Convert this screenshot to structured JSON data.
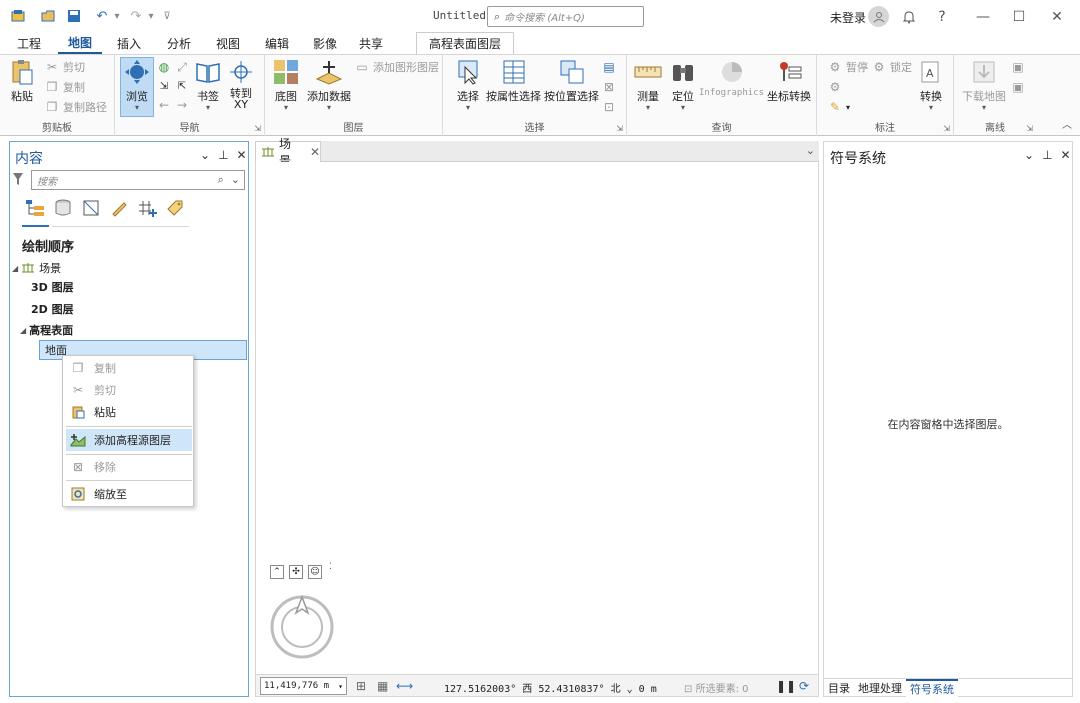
{
  "titlebar": {
    "title": "Untitled",
    "command_search_placeholder": "命令搜索 (Alt+Q)",
    "login_label": "未登录",
    "help": "?"
  },
  "ribbon_tabs": [
    "工程",
    "地图",
    "插入",
    "分析",
    "视图",
    "编辑",
    "影像",
    "共享"
  ],
  "active_tab": "地图",
  "context_tab": "高程表面图层",
  "ribbon": {
    "clipboard": {
      "label": "剪贴板",
      "paste": "粘贴",
      "cut": "剪切",
      "copy": "复制",
      "copy_path": "复制路径"
    },
    "navigate": {
      "label": "导航",
      "explore": "浏览",
      "bookmarks": "书签",
      "go_to_xy": "转到\nXY"
    },
    "layer": {
      "label": "图层",
      "basemap": "底图",
      "add_data": "添加数据",
      "add_graphics_layer": "添加图形图层"
    },
    "selection": {
      "label": "选择",
      "select": "选择",
      "select_by_attributes": "按属性选择",
      "select_by_location": "按位置选择"
    },
    "inquiry": {
      "label": "查询",
      "measure": "测量",
      "locate": "定位",
      "infographics": "Infographics",
      "convert_coordinates": "坐标转换"
    },
    "labeling": {
      "label": "标注",
      "pause": "暂停",
      "lock": "锁定",
      "convert": "转换"
    },
    "offline": {
      "label": "离线",
      "download_map": "下载地图"
    }
  },
  "contents": {
    "title": "内容",
    "search_placeholder": "搜索",
    "drawing_order": "绘制顺序",
    "scene": "场景",
    "layers_3d": "3D 图层",
    "layers_2d": "2D 图层",
    "elevation_surfaces": "高程表面",
    "ground": "地面"
  },
  "context_menu": {
    "copy": "复制",
    "cut": "剪切",
    "paste": "粘贴",
    "add_elevation_source": "添加高程源图层",
    "remove": "移除",
    "zoom_to": "缩放至"
  },
  "view_tab": "场景",
  "statusbar": {
    "scale": "11,419,776 m",
    "longitude": "127.5162003°",
    "lon_dir": "西",
    "latitude": "52.4310837°",
    "lat_dir": "北",
    "elevation": "0 m",
    "selected_features": "所选要素: 0"
  },
  "symbology": {
    "title": "符号系统",
    "empty_message": "在内容窗格中选择图层。"
  },
  "bottom_tabs": [
    "目录",
    "地理处理",
    "符号系统"
  ],
  "active_bottom_tab": "符号系统"
}
